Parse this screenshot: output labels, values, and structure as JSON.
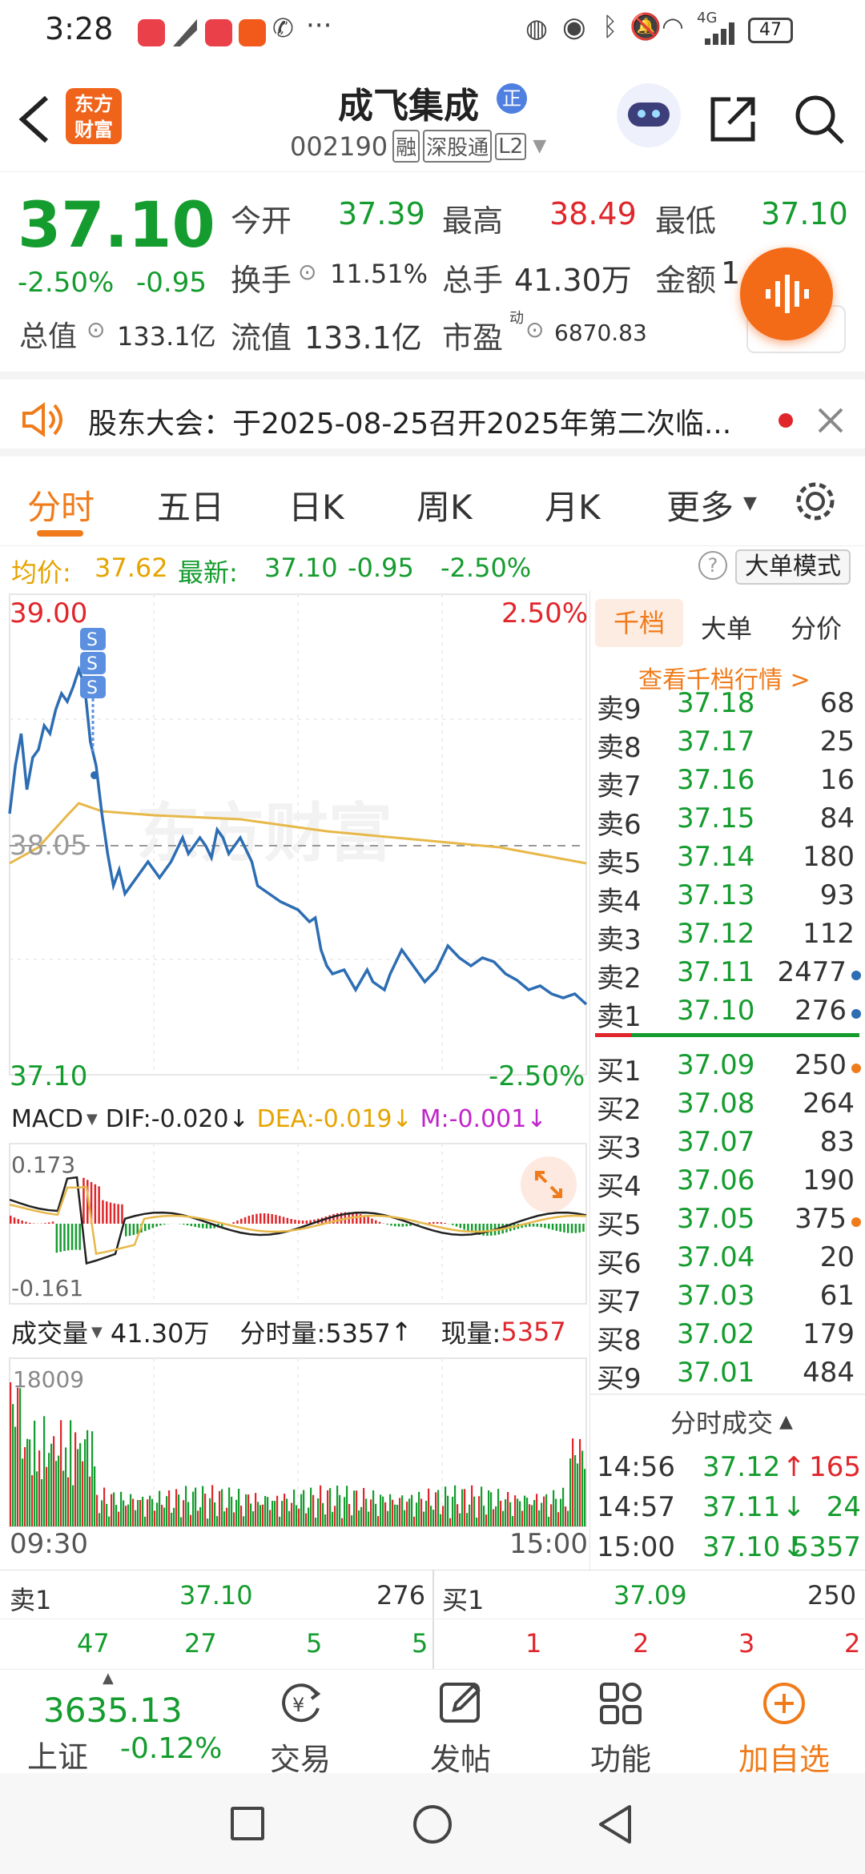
{
  "status": {
    "time": "3:28",
    "battery": "47",
    "network": "4G"
  },
  "header": {
    "brand_line1": "东方",
    "brand_line2": "财富",
    "stock_name": "成飞集成",
    "badge": "正",
    "code": "002190",
    "tags": [
      "融",
      "深股通",
      "L2"
    ]
  },
  "quote": {
    "price": "37.10",
    "change_pct": "-2.50%",
    "change_amt": "-0.95",
    "fields": [
      {
        "label": "今开",
        "value": "37.39"
      },
      {
        "label": "最高",
        "value": "38.49"
      },
      {
        "label": "最低",
        "value": "37.10"
      },
      {
        "label": "换手",
        "value": "11.51%"
      },
      {
        "label": "总手",
        "value": "41.30万"
      },
      {
        "label": "金额",
        "value": "1"
      },
      {
        "label": "总值",
        "value": "133.1亿"
      },
      {
        "label": "流值",
        "value": "133.1亿"
      },
      {
        "label": "市盈",
        "sup": "动",
        "value": "6870.83"
      }
    ]
  },
  "notice": {
    "text": "股东大会：于2025-08-25召开2025年第二次临..."
  },
  "tabs": [
    "分时",
    "五日",
    "日K",
    "周K",
    "月K",
    "更多"
  ],
  "summary": {
    "avg_label": "均价:",
    "avg": "37.62",
    "latest_label": "最新:",
    "latest": "37.10",
    "chg": "-0.95",
    "pct": "-2.50%",
    "mode": "大单模式"
  },
  "chart": {
    "top": "39.00",
    "top_pct": "2.50%",
    "mid": "38.05",
    "bottom": "37.10",
    "bottom_pct": "-2.50%",
    "watermark": "东方财富",
    "start_time": "09:30",
    "end_time": "15:00",
    "marker": "S"
  },
  "macd": {
    "name": "MACD",
    "dif": "DIF:-0.020",
    "dea": "DEA:-0.019",
    "m": "M:-0.001",
    "max": "0.173",
    "min": "-0.161"
  },
  "volume": {
    "name": "成交量",
    "total": "41.30万",
    "tick": "分时量:5357",
    "now_label": "现量:",
    "now": "5357",
    "max": "18009"
  },
  "book": {
    "tabs": [
      "千档",
      "大单",
      "分价"
    ],
    "link": "查看千档行情 >",
    "asks": [
      {
        "l": "卖9",
        "p": "37.18",
        "v": "68"
      },
      {
        "l": "卖8",
        "p": "37.17",
        "v": "25"
      },
      {
        "l": "卖7",
        "p": "37.16",
        "v": "16"
      },
      {
        "l": "卖6",
        "p": "37.15",
        "v": "84"
      },
      {
        "l": "卖5",
        "p": "37.14",
        "v": "180"
      },
      {
        "l": "卖4",
        "p": "37.13",
        "v": "93"
      },
      {
        "l": "卖3",
        "p": "37.12",
        "v": "112"
      },
      {
        "l": "卖2",
        "p": "37.11",
        "v": "2477"
      },
      {
        "l": "卖1",
        "p": "37.10",
        "v": "276"
      }
    ],
    "bids": [
      {
        "l": "买1",
        "p": "37.09",
        "v": "250"
      },
      {
        "l": "买2",
        "p": "37.08",
        "v": "264"
      },
      {
        "l": "买3",
        "p": "37.07",
        "v": "83"
      },
      {
        "l": "买4",
        "p": "37.06",
        "v": "190"
      },
      {
        "l": "买5",
        "p": "37.05",
        "v": "375"
      },
      {
        "l": "买6",
        "p": "37.04",
        "v": "20"
      },
      {
        "l": "买7",
        "p": "37.03",
        "v": "61"
      },
      {
        "l": "买8",
        "p": "37.02",
        "v": "179"
      },
      {
        "l": "买9",
        "p": "37.01",
        "v": "484"
      }
    ],
    "trades_title": "分时成交",
    "trades": [
      {
        "t": "14:56",
        "p": "37.12",
        "a": "↑",
        "v": "165"
      },
      {
        "t": "14:57",
        "p": "37.11",
        "a": "↓",
        "v": "24"
      },
      {
        "t": "15:00",
        "p": "37.10",
        "a": "↓",
        "v": "5357"
      }
    ]
  },
  "l1": {
    "sell_label": "卖1",
    "sell_price": "37.10",
    "sell_vol": "276",
    "buy_label": "买1",
    "buy_price": "37.09",
    "buy_vol": "250",
    "sell_queue": [
      "47",
      "27",
      "5",
      "5"
    ],
    "buy_queue": [
      "1",
      "2",
      "3",
      "2"
    ]
  },
  "bottom": {
    "index_value": "3635.13",
    "index_name": "上证",
    "index_pct": "-0.12%",
    "items": [
      "交易",
      "发帖",
      "功能",
      "加自选"
    ]
  },
  "colors": {
    "up": "#e0262b",
    "down": "#149c2e",
    "price_line": "#2c6db3",
    "avg_line": "#e7b84a",
    "accent": "#f07b1a"
  }
}
